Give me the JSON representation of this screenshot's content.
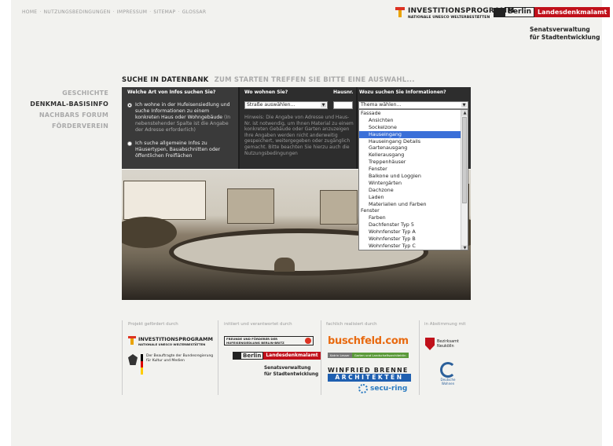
{
  "topnav": {
    "items": [
      "HOME",
      "NUTZUNGSBEDINGUNGEN",
      "IMPRESSUM",
      "SITEMAP",
      "GLOSSAR"
    ],
    "separator": "·"
  },
  "header": {
    "invest_title": "INVESTITIONSPROGRAMM",
    "invest_sub": "NATIONALE UNESCO WELTERBESTÄTTEN",
    "berlin_word": "Berlin",
    "landesdenkmalamt": "Landesdenkmalamt",
    "senat_line1": "Senatsverwaltung",
    "senat_line2": "für Stadtentwicklung"
  },
  "sidenav": {
    "items": [
      {
        "label": "GESCHICHTE"
      },
      {
        "label": "DENKMAL-BASISINFO"
      },
      {
        "label": "NACHBARS FORUM"
      },
      {
        "label": "FÖRDERVEREIN"
      }
    ]
  },
  "main": {
    "heading": "SUCHE IN DATENBANK",
    "subheading": "ZUM STARTEN TREFFEN SIE BITTE EINE AUSWAHL..."
  },
  "form": {
    "col1_header": "Welche Art von Infos suchen Sie?",
    "option1_text": "Ich wohne in der Hufeisensiedlung und suche Informationen zu einem konkreten Haus oder Wohngebäude",
    "option1_hint": "(In nebenstehender Spalte ist die Angabe der Adresse erforderlich)",
    "option2_text": "Ich suche allgemeine Infos zu Häusertypen, Bauabschnitten oder öffentlichen Freiflächen",
    "col2_header": "Wo wohnen Sie?",
    "hausnr_header": "Hausnr.",
    "street_select": "Straße auswählen...",
    "hinweis": "Hinweis: Die Angabe von Adresse und Haus-Nr. ist notwendig, um Ihnen Material zu einem konkreten Gebäude oder Garten anzuzeigen Ihre Angaben werden nicht anderweitig gespeichert, weitergegeben oder zugänglich gemacht. Bitte beachten Sie hierzu auch die Nutzungsbedingungen",
    "col3_header": "Wozu suchen Sie Informationen?",
    "thema_select": "Thema wählen..."
  },
  "dropdown": {
    "items": [
      {
        "label": "Fassade",
        "group": true
      },
      {
        "label": "Ansichten"
      },
      {
        "label": "Sockelzone"
      },
      {
        "label": "Hauseingang",
        "selected": true
      },
      {
        "label": "Hauseingang Details"
      },
      {
        "label": "Gartenausgang"
      },
      {
        "label": "Kellerausgang"
      },
      {
        "label": "Treppenhäuser"
      },
      {
        "label": "Fenster"
      },
      {
        "label": "Balkone und Loggien"
      },
      {
        "label": "Wintergärten"
      },
      {
        "label": "Dachzone"
      },
      {
        "label": "Laden"
      },
      {
        "label": "Materialien und Farben"
      },
      {
        "label": "Fenster",
        "group": true
      },
      {
        "label": "Farben"
      },
      {
        "label": "Dachfenster Typ 5"
      },
      {
        "label": "Wohnfenster Typ A"
      },
      {
        "label": "Wohnfenster Typ B"
      },
      {
        "label": "Wohnfenster Typ C"
      }
    ]
  },
  "footer": {
    "label1": "Projekt gefördert durch",
    "label2": "initiiert und verantwortet durch",
    "label3": "fachlich realisiert durch",
    "label4": "in Abstimmung mit",
    "invest_title": "INVESTITIONSPROGRAMM",
    "invest_sub": "NATIONALE UNESCO WELTERBESTÄTTEN",
    "bund_line1": "Der Beauftragte der Bundesregierung",
    "bund_line2": "für Kultur und Medien",
    "freunde_line1": "FREUNDE UND FÖRDERER DER",
    "freunde_line2": "HUFEISENSIEDLUNG BERLIN-BRITZ",
    "berlin_word": "Berlin",
    "landesdenkmalamt": "Landesdenkmalamt",
    "senat_line1": "Senatsverwaltung",
    "senat_line2": "für Stadtentwicklung",
    "buschfeld": "buschfeld.com",
    "katrin": "Katrin Lesser",
    "katrin_sub": "Garten und Landschaftsarchitektin",
    "brenne1": "WINFRIED BRENNE",
    "brenne2": "ARCHITEKTEN",
    "secu": "secu-ring",
    "neukoelln_line1": "Bezirksamt",
    "neukoelln_line2": "Neukölln",
    "dw_line1": "Deutsche",
    "dw_line2": "Wohnen"
  },
  "colors": {
    "accent_red": "#c0101a",
    "selection_blue": "#3a6fd8",
    "buschfeld_orange": "#e86a10",
    "brenne_blue": "#1f5fb0"
  }
}
